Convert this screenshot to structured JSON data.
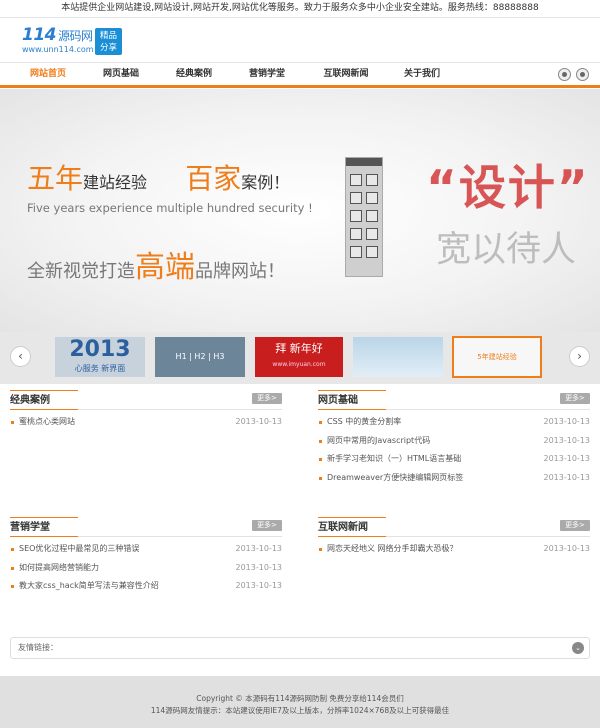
{
  "topbar": {
    "text": "本站提供企业网站建设,网站设计,网站开发,网站优化等服务。致力于服务众多中小企业安全建站。服务热线：88888888"
  },
  "logo": {
    "main": "114",
    "main_cn": "源码网",
    "url": "www.unn114.com",
    "badge_line1": "精品",
    "badge_line2": "分享"
  },
  "nav": {
    "items": [
      {
        "label": "网站首页",
        "active": true
      },
      {
        "label": "网页基础"
      },
      {
        "label": "经典案例"
      },
      {
        "label": "营销学堂"
      },
      {
        "label": "互联网新闻"
      },
      {
        "label": "关于我们"
      }
    ]
  },
  "banner": {
    "line1_a": "五年",
    "line1_b": "建站经验",
    "line1_c": "百家",
    "line1_d": "案例！",
    "line2": "Five years experience multiple hundred security !",
    "line3_a": "全新视觉打造",
    "line3_b": "高端",
    "line3_c": "品牌网站！",
    "right_big": "“设计”",
    "right_sub": "宽以待人"
  },
  "slider": {
    "prev": "‹",
    "next": "›",
    "thumbs": [
      {
        "text": "2013",
        "sub": "心服务 新界面"
      },
      {
        "text": "H1 | H2 | H3",
        "sub": ""
      },
      {
        "text": "拜 新年好",
        "sub": "www.imyuan.com"
      },
      {
        "text": "",
        "sub": ""
      },
      {
        "text": "5年建站经验",
        "sub": ""
      }
    ]
  },
  "sections": {
    "classic": {
      "title": "经典案例",
      "more": "更多>",
      "items": [
        {
          "title": "蜜桃点心类网站",
          "date": "2013-10-13"
        }
      ]
    },
    "basics": {
      "title": "网页基础",
      "more": "更多>",
      "items": [
        {
          "title": "CSS 中的黄金分割率",
          "date": "2013-10-13"
        },
        {
          "title": "网页中常用的Javascript代码",
          "date": "2013-10-13"
        },
        {
          "title": "新手学习老知识（一）HTML语言基础",
          "date": "2013-10-13"
        },
        {
          "title": "Dreamweaver方便快捷编辑网页标签",
          "date": "2013-10-13"
        }
      ]
    },
    "marketing": {
      "title": "营销学堂",
      "more": "更多>",
      "items": [
        {
          "title": "SEO优化过程中最常见的三种错误",
          "date": "2013-10-13"
        },
        {
          "title": "如何提高网络营销能力",
          "date": "2013-10-13"
        },
        {
          "title": "教大家css_hack简单写法与兼容性介绍",
          "date": "2013-10-13"
        }
      ]
    },
    "news": {
      "title": "互联网新闻",
      "more": "更多>",
      "items": [
        {
          "title": "网恋天经地义 网络分手却霸大恐极？",
          "date": "2013-10-13"
        }
      ]
    }
  },
  "links": {
    "label": "友情链接：",
    "toggle": "⌄"
  },
  "footer": {
    "line1": "Copyright © 本源码有114源码网防制 免费分享给114会员们",
    "line2": "114源码网友情提示：本站建议使用IE7及以上版本，分辨率1024×768及以上可获得最佳"
  }
}
